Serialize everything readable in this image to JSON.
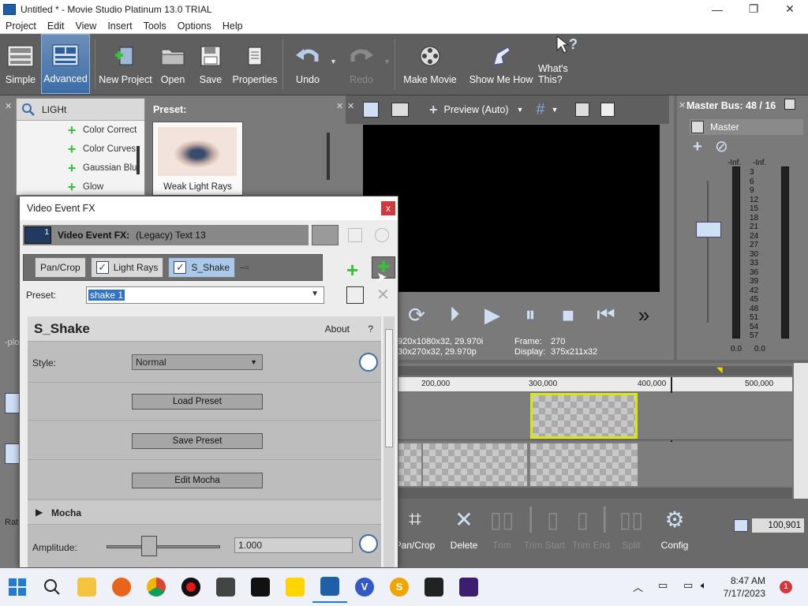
{
  "window": {
    "title": "Untitled * - Movie Studio Platinum 13.0 TRIAL",
    "minimize": "—",
    "maximize": "❐",
    "close": "✕"
  },
  "menu": [
    "Project",
    "Edit",
    "View",
    "Insert",
    "Tools",
    "Options",
    "Help"
  ],
  "toolbar": {
    "simple": "Simple",
    "advanced": "Advanced",
    "new_project": "New Project",
    "open": "Open",
    "save": "Save",
    "properties": "Properties",
    "undo": "Undo",
    "redo": "Redo",
    "make_movie": "Make Movie",
    "show_me_how": "Show Me How",
    "whats_this": "What's This?"
  },
  "explorer": {
    "search_value": "LIGHt",
    "items": [
      "Color Correct",
      "Color Curves",
      "Gaussian Blur",
      "Glow"
    ]
  },
  "preset_pane": {
    "label": "Preset:",
    "thumb_caption": "Weak Light Rays"
  },
  "preview": {
    "mode": "Preview (Auto)",
    "info_left_1": "920x1080x32, 29.970i",
    "info_left_2": "30x270x32, 29.970p",
    "frame_label": "Frame:",
    "frame_value": "270",
    "display_label": "Display:",
    "display_value": "375x211x32"
  },
  "master_bus": {
    "title": "Master Bus: 48 / 16",
    "master_label": "Master",
    "left_inf": "-Inf.",
    "right_inf": "-Inf.",
    "scale": [
      "3",
      "6",
      "9",
      "12",
      "15",
      "18",
      "21",
      "24",
      "27",
      "30",
      "33",
      "36",
      "39",
      "42",
      "45",
      "48",
      "51",
      "54",
      "57"
    ],
    "left_val": "0.0",
    "right_val": "0.0"
  },
  "timeline": {
    "ruler": [
      "200,000",
      "300,000",
      "400,000",
      "500,000"
    ],
    "time_value": "100,901"
  },
  "left_stub": {
    "text1": "-plo",
    "text2": "Rat"
  },
  "edit_tools": {
    "pan_crop": "Pan/Crop",
    "delete": "Delete",
    "trim": "Trim",
    "trim_start": "Trim Start",
    "trim_end": "Trim End",
    "split": "Split",
    "config": "Config"
  },
  "dialog": {
    "title": "Video Event FX",
    "close": "x",
    "badge": "1",
    "fx_label": "Video Event FX:",
    "fx_value": "(Legacy) Text 13",
    "chain": [
      "Pan/Crop",
      "Light Rays",
      "S_Shake"
    ],
    "preset_label": "Preset:",
    "preset_value": "shake 1",
    "plugin_name": "S_Shake",
    "about": "About",
    "help": "?",
    "style_label": "Style:",
    "style_value": "Normal",
    "load_preset": "Load Preset",
    "save_preset": "Save Preset",
    "edit_mocha": "Edit Mocha",
    "mocha_section": "Mocha",
    "amplitude_label": "Amplitude:",
    "amplitude_value": "1.000",
    "amplitude_level": 0.1
  },
  "taskbar": {
    "time": "8:47 AM",
    "date": "7/17/2023",
    "notif_count": "1",
    "app_labels": {
      "v": "V",
      "s": "S"
    }
  },
  "colors": {
    "accent": "#3d6da8",
    "plus_green": "#3bbf3b",
    "clip_outline": "#d9e80a",
    "close_red": "#d0383e"
  }
}
